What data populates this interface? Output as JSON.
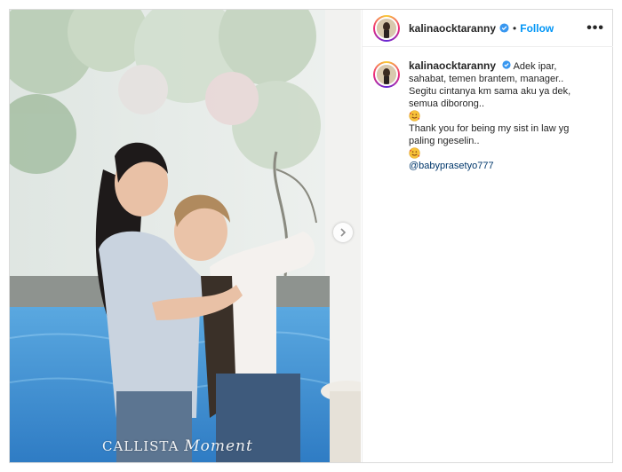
{
  "post": {
    "username": "kalinaocktaranny",
    "follow_label": "Follow",
    "separator": "•",
    "more_label": "•••",
    "watermark_main": "CALLISTA",
    "watermark_script": "Moment",
    "caption": {
      "username": "kalinaocktaranny",
      "line1": "Adek ipar,",
      "line2": "sahabat, temen brantem, manager..",
      "line3": "Segitu cintanya km sama aku ya dek,",
      "line4": "semua diborong..",
      "line5": "Thank you for being my sist in law yg",
      "line6": "paling ngeselin..",
      "mention": "@babyprasetyo777"
    },
    "icons": {
      "verified": "verified-badge-icon",
      "next": "chevron-right-icon",
      "emoji": "smiling-face-with-hearts-icon"
    },
    "colors": {
      "accent": "#0095f6",
      "verified": "#3897f0",
      "mention": "#00376b"
    }
  }
}
